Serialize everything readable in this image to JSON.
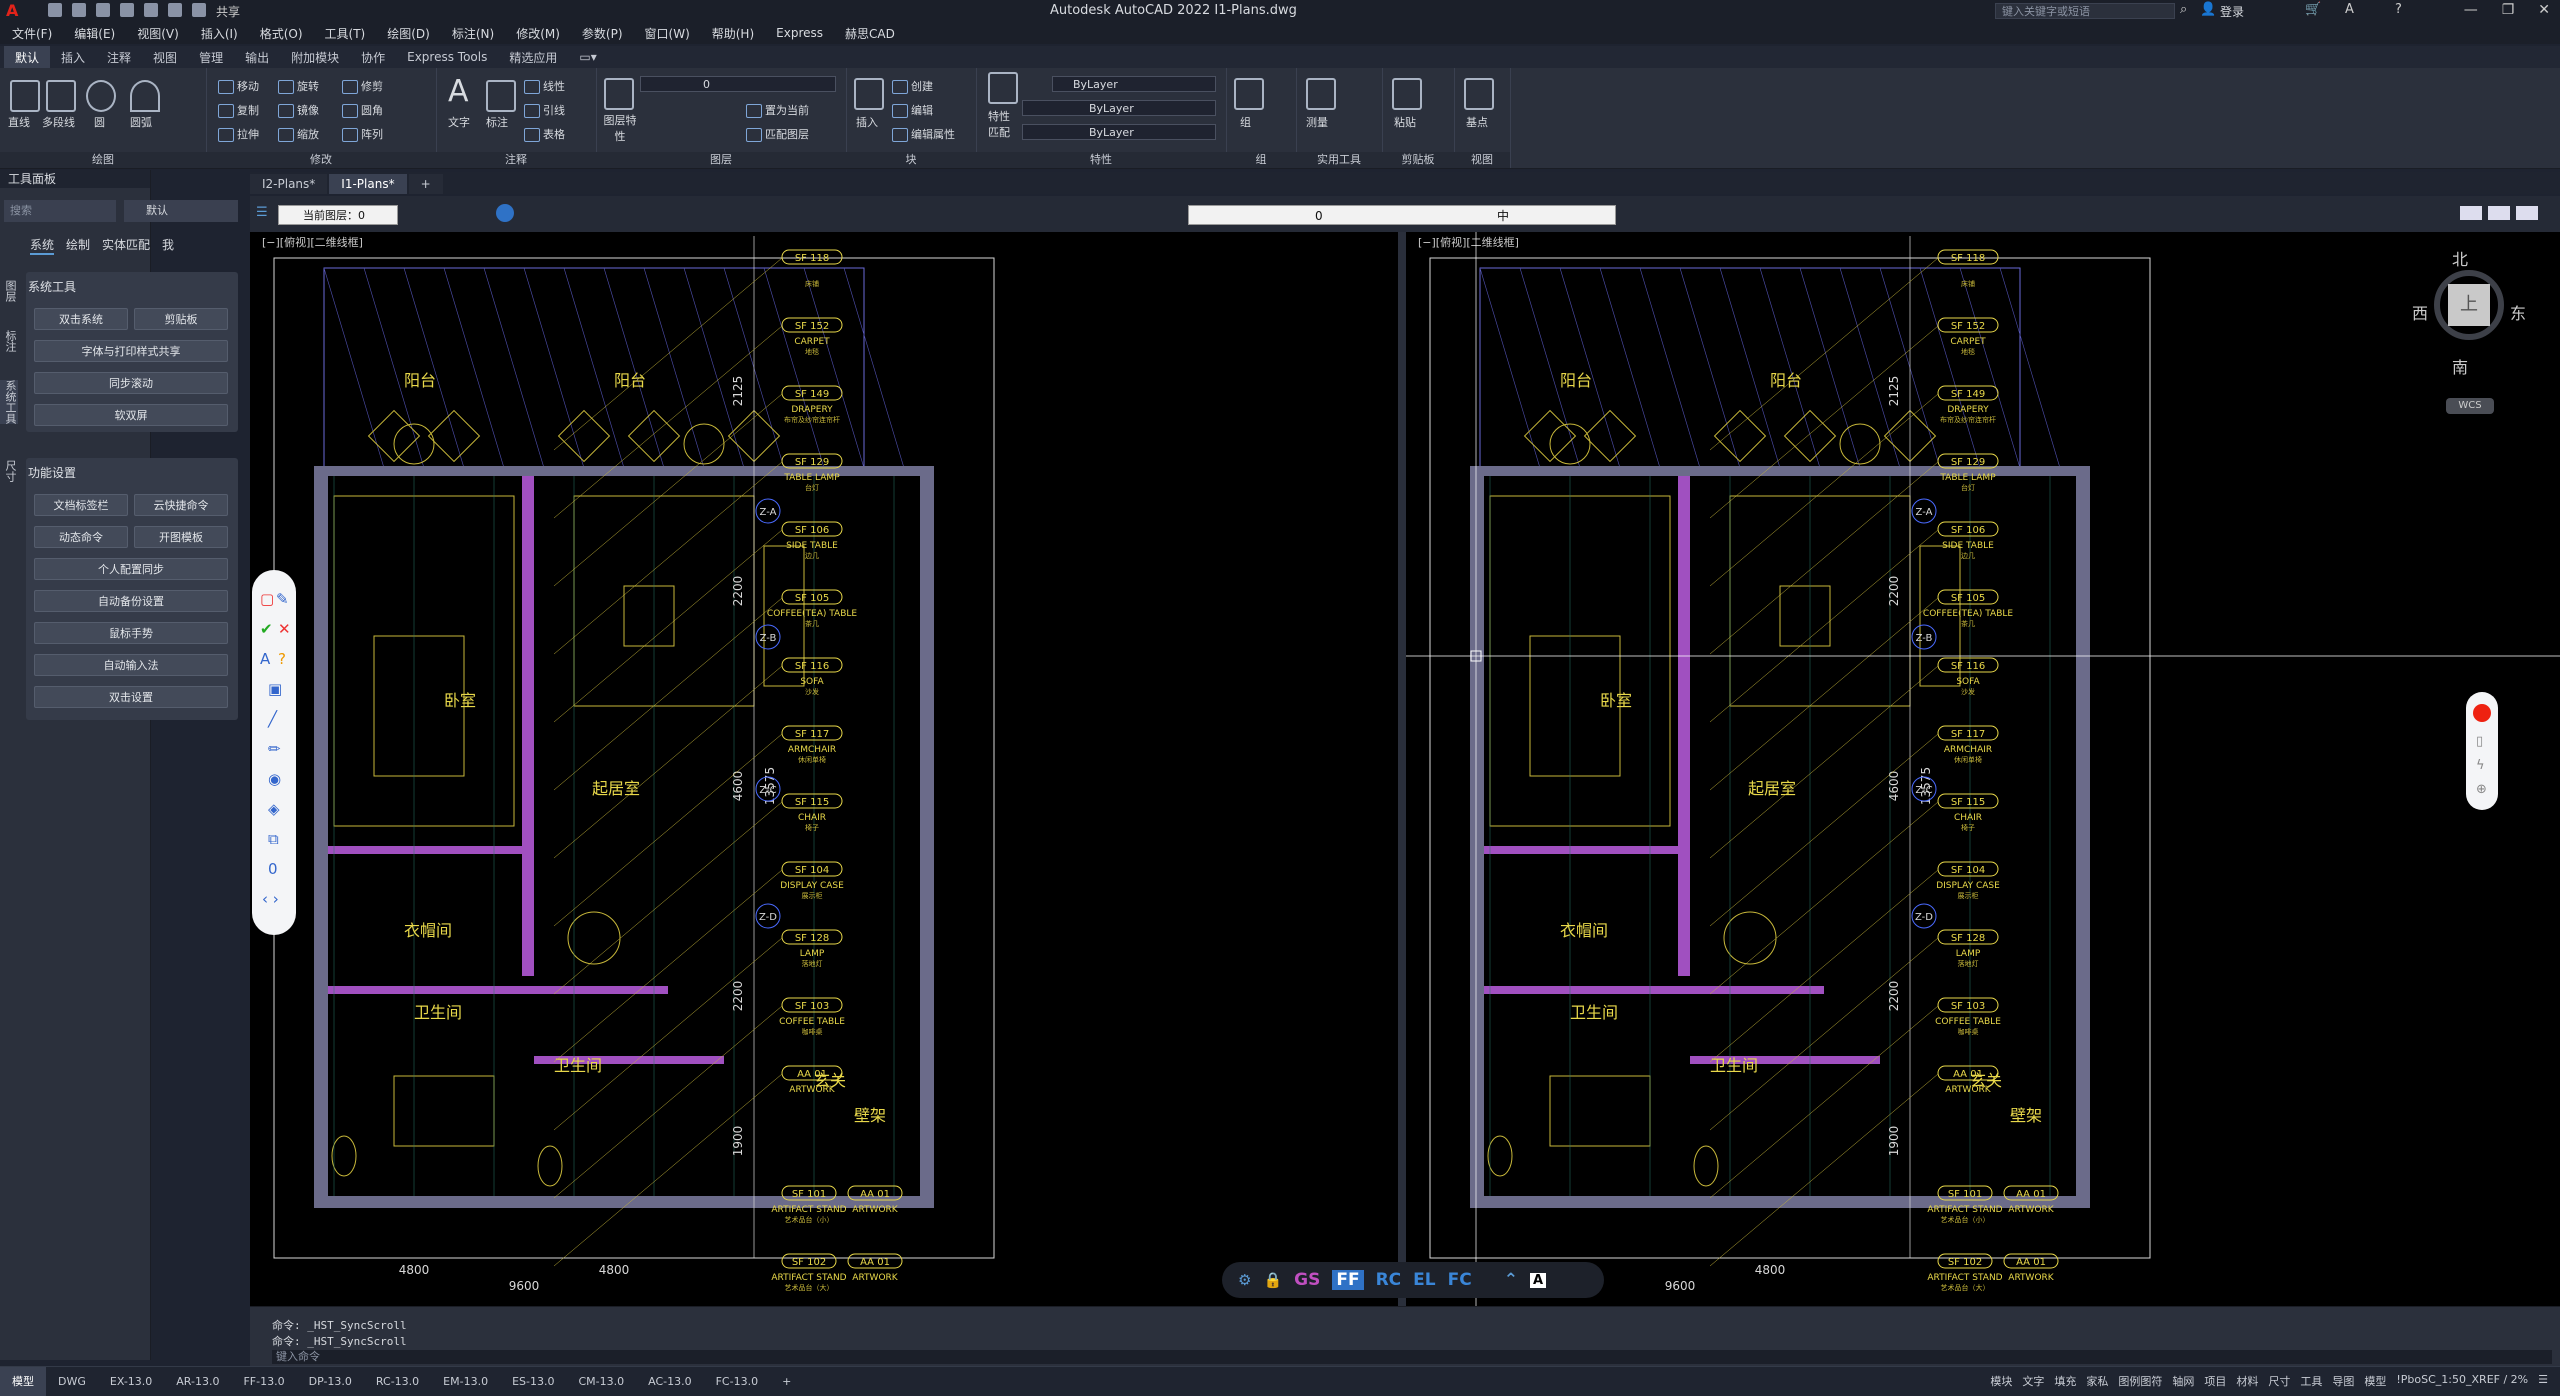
{
  "titlebar": {
    "app_title": "Autodesk AutoCAD 2022   I1-Plans.dwg",
    "share": "共享",
    "search_placeholder": "键入关键字或短语",
    "login": "登录"
  },
  "menu": [
    "文件(F)",
    "编辑(E)",
    "视图(V)",
    "插入(I)",
    "格式(O)",
    "工具(T)",
    "绘图(D)",
    "标注(N)",
    "修改(M)",
    "参数(P)",
    "窗口(W)",
    "帮助(H)",
    "Express",
    "赫思CAD"
  ],
  "ribbon_tabs": [
    "默认",
    "插入",
    "注释",
    "视图",
    "管理",
    "输出",
    "附加模块",
    "协作",
    "Express Tools",
    "精选应用"
  ],
  "ribbon": {
    "draw": {
      "title": "绘图",
      "line": "直线",
      "polyline": "多段线",
      "circle": "圆",
      "arc": "圆弧"
    },
    "modify": {
      "title": "修改",
      "move": "移动",
      "rotate": "旋转",
      "trim": "修剪",
      "copy": "复制",
      "mirror": "镜像",
      "fillet": "圆角",
      "stretch": "拉伸",
      "scale": "缩放",
      "array": "阵列"
    },
    "annotation": {
      "title": "注释",
      "text": "文字",
      "dimension": "标注",
      "linear": "线性",
      "leader": "引线",
      "table": "表格"
    },
    "layers": {
      "title": "图层",
      "properties": "图层特性",
      "layer_value": "0",
      "make_current": "置为当前",
      "match_layer": "匹配图层"
    },
    "block": {
      "title": "块",
      "insert": "插入",
      "create": "创建",
      "edit": "编辑",
      "edit_attr": "编辑属性"
    },
    "properties": {
      "title": "特性",
      "match": "特性匹配",
      "color": "ByLayer",
      "linetype": "ByLayer",
      "lineweight": "ByLayer"
    },
    "groups": {
      "title": "组",
      "group": "组"
    },
    "utilities": {
      "title": "实用工具",
      "measure": "测量"
    },
    "clipboard": {
      "title": "剪贴板",
      "paste": "粘贴"
    },
    "view": {
      "title": "视图",
      "base": "基点"
    }
  },
  "palette": {
    "title": "工具面板",
    "search_placeholder": "搜索",
    "default_label": "默认",
    "subtabs": [
      "系统",
      "绘制",
      "实体匹配",
      "我"
    ],
    "side_tabs": [
      "图层",
      "标注",
      "系统工具",
      "尺寸"
    ],
    "section1": "系统工具",
    "section1_buttons": [
      "双击系统",
      "剪贴板",
      "字体与打印样式共享",
      "同步滚动",
      "软双屏"
    ],
    "section2": "功能设置",
    "section2_buttons": [
      "文档标签栏",
      "云快捷命令",
      "动态命令",
      "开图模板",
      "个人配置同步",
      "自动备份设置",
      "鼠标手势",
      "自动输入法",
      "双击设置"
    ]
  },
  "doc_tabs": [
    "I2-Plans*",
    "I1-Plans*"
  ],
  "viewport": {
    "current_layer_label": "当前图层：0",
    "layer_bar_value": "0",
    "layer_bar_lang": "中",
    "view_label_left": "[−][俯视][二维线框]",
    "view_label_right": "[−][俯视][二维线框]",
    "compass": {
      "north": "北",
      "south": "南",
      "east": "东",
      "west": "西",
      "center": "上",
      "wcs": "WCS"
    }
  },
  "plan": {
    "rooms": [
      "阳台",
      "阳台",
      "卧室",
      "起居室",
      "衣帽间",
      "卫生间",
      "卫生间",
      "玄关",
      "壁架"
    ],
    "dims": [
      "4800",
      "4800",
      "9600",
      "2125",
      "2200",
      "4600",
      "13575",
      "2200",
      "1900"
    ],
    "grid_bubbles": [
      "Z-A",
      "Z-B",
      "Z-C",
      "Z-D"
    ],
    "tags": [
      {
        "code": "SF 118",
        "label": "",
        "sub": "床铺"
      },
      {
        "code": "SF 152",
        "label": "CARPET",
        "sub": "地毯"
      },
      {
        "code": "SF 149",
        "label": "DRAPERY",
        "sub": "布帘及纱帘连帘杆"
      },
      {
        "code": "SF 129",
        "label": "TABLE LAMP",
        "sub": "台灯"
      },
      {
        "code": "SF 106",
        "label": "SIDE TABLE",
        "sub": "边几"
      },
      {
        "code": "SF 105",
        "label": "COFFEE(TEA) TABLE",
        "sub": "茶几"
      },
      {
        "code": "SF 116",
        "label": "SOFA",
        "sub": "沙发"
      },
      {
        "code": "SF 117",
        "label": "ARMCHAIR",
        "sub": "休闲单椅"
      },
      {
        "code": "SF 115",
        "label": "CHAIR",
        "sub": "椅子"
      },
      {
        "code": "SF 104",
        "label": "DISPLAY CASE",
        "sub": "展示柜"
      },
      {
        "code": "SF 128",
        "label": "LAMP",
        "sub": "落地灯"
      },
      {
        "code": "SF 103",
        "label": "COFFEE TABLE",
        "sub": "咖啡桌"
      },
      {
        "code": "AA 01",
        "label": "ARTWORK",
        "sub": ""
      }
    ],
    "bottom_tags": [
      {
        "code": "SF 101",
        "label": "ARTIFACT STAND",
        "sub": "艺术品台（小）",
        "code2": "AA 01",
        "label2": "ARTWORK"
      },
      {
        "code": "SF 102",
        "label": "ARTIFACT STAND",
        "sub": "艺术品台（大）",
        "code2": "AA 01",
        "label2": "ARTWORK"
      }
    ]
  },
  "snapbar": [
    "GS",
    "FF",
    "RC",
    "EL",
    "FC"
  ],
  "command": {
    "line1": "命令: _HST_SyncScroll",
    "line2": "命令: _HST_SyncScroll",
    "input_placeholder": "键入命令"
  },
  "status_tabs": [
    "模型",
    "DWG",
    "EX-13.0",
    "AR-13.0",
    "FF-13.0",
    "DP-13.0",
    "RC-13.0",
    "EM-13.0",
    "ES-13.0",
    "CM-13.0",
    "AC-13.0",
    "FC-13.0"
  ],
  "status_right": [
    "模块",
    "文字",
    "填充",
    "家私",
    "图例图符",
    "轴网",
    "项目",
    "材料",
    "尺寸",
    "工具",
    "导图",
    "模型",
    "!PboSC_1:50_XREF / 2%"
  ]
}
